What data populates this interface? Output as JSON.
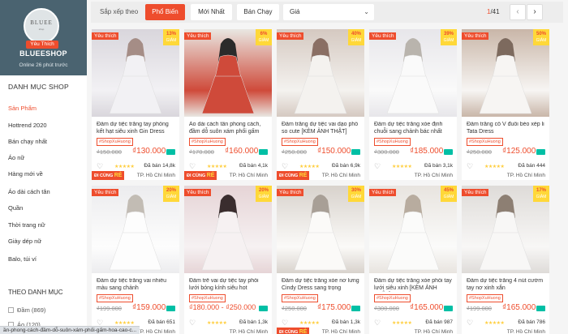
{
  "shop": {
    "logo_text": "BLUEE",
    "logo_sub": "shop",
    "favorite_badge": "Yêu Thích",
    "name": "BLUEESHOP",
    "online": "Online 26 phút trước"
  },
  "sidebar": {
    "category_title": "DANH MỤC SHOP",
    "categories": [
      {
        "label": "Sản Phẩm",
        "active": true
      },
      {
        "label": "Hottrend 2020"
      },
      {
        "label": "Bán chạy nhất"
      },
      {
        "label": "Áo nữ"
      },
      {
        "label": "Hàng mới về"
      },
      {
        "label": "Áo dài cách tân"
      },
      {
        "label": "Quần"
      },
      {
        "label": "Thời trang nữ"
      },
      {
        "label": "Giày dép nữ"
      },
      {
        "label": "Balo, túi ví"
      }
    ],
    "filter_title": "THEO DANH MỤC",
    "filters": [
      {
        "label": "Đầm (869)"
      },
      {
        "label": "Áo (120)"
      }
    ]
  },
  "sortbar": {
    "label": "Sắp xếp theo",
    "options": [
      {
        "label": "Phổ Biến",
        "active": true
      },
      {
        "label": "Mới Nhất"
      },
      {
        "label": "Bán Chạy"
      }
    ],
    "price_label": "Giá",
    "page_current": "1",
    "page_total": "/41",
    "prev_icon": "‹",
    "next_icon": "›"
  },
  "colors": {
    "accent": "#ee4d2d",
    "badge_yellow": "#ffd839",
    "shop_banner": "#4a6370"
  },
  "products": [
    {
      "fav": "Yêu thích",
      "discount": "13%",
      "discount_label": "GIẢM",
      "re": true,
      "name": "Đầm dự tiệc trắng tay phồng kết hạt siêu xinh Gin Dress",
      "tag": "#ShopXuHuong",
      "old_price": "₫150.000",
      "new_price": "₫130.000",
      "sold": "Đã bán 14,8k",
      "location": "TP. Hồ Chí Minh",
      "bg": [
        "#d9d6dc",
        "#f2f1f4",
        "#a58d86"
      ]
    },
    {
      "fav": "Yêu thích",
      "discount": "6%",
      "discount_label": "GIẢM",
      "re": true,
      "name": "Áo dài cách tân phong cách, đầm dỗ suôn xám phối gấm hoa",
      "tag": "#ShopXuHuong",
      "old_price": "₫170.000",
      "new_price": "₫160.000",
      "sold": "Đã bán 4,1k",
      "location": "TP. Hồ Chí Minh",
      "bg": [
        "#e9e7e2",
        "#cf4a3a",
        "#2b2b2b"
      ]
    },
    {
      "fav": "Yêu thích",
      "discount": "40%",
      "discount_label": "GIẢM",
      "re": true,
      "name": "Đầm trắng dự tiệc vai dạo phố so cute [KÈM ẢNH THẬT]",
      "tag": "#ShopXuHuong",
      "old_price": "₫250.000",
      "new_price": "₫150.000",
      "sold": "Đã bán 6,9k",
      "location": "TP. Hồ Chí Minh",
      "bg": [
        "#d5c9c1",
        "#f4f2ef",
        "#8a6f64"
      ]
    },
    {
      "fav": "Yêu thích",
      "discount": "39%",
      "discount_label": "GIẢM",
      "re": false,
      "name": "Đầm dự tiệc trắng xòe định chuỗi sang chảnh bác nhất",
      "tag": "#ShopXuHuong",
      "old_price": "₫300.000",
      "new_price": "₫185.000",
      "sold": "Đã bán 3,1k",
      "location": "TP. Hồ Chí Minh",
      "bg": [
        "#e7e6ea",
        "#fafafa",
        "#b9b4ad"
      ]
    },
    {
      "fav": "Yêu thích",
      "discount": "50%",
      "discount_label": "GIẢM",
      "re": false,
      "name": "Đầm trắng cổ V đuôi bèo xếp li Tata Dress",
      "tag": "#ShopXuHuong",
      "old_price": "₫250.000",
      "new_price": "₫125.000",
      "sold": "Đã bán 444",
      "location": "TP. Hồ Chí Minh",
      "bg": [
        "#c9b6a8",
        "#f7f5f3",
        "#7d6a5e"
      ]
    },
    {
      "fav": "Yêu thích",
      "discount": "20%",
      "discount_label": "GIẢM",
      "re": false,
      "name": "Đầm dự tiệc trắng vai nhiều màu sang chảnh",
      "tag": "#ShopXuHuong",
      "old_price": "₫199.000",
      "new_price": "₫159.000",
      "sold": "Đã bán 651",
      "location": "TP. Hồ Chí Minh",
      "bg": [
        "#ececee",
        "#fdfdfd",
        "#c2bcb4"
      ]
    },
    {
      "fav": "Yêu thích",
      "discount": "20%",
      "discount_label": "GIẢM",
      "re": false,
      "name": "Đầm trễ vai dự tiệc tay phối lưới bóng kính siêu hot",
      "tag": "#ShopXuHuong",
      "old_price": "",
      "new_price": "₫180.000 - ₫250.000",
      "sold": "Đã bán 1,3k",
      "location": "TP. Hồ Chí Minh",
      "bg": [
        "#e6d4d6",
        "#f6f1f2",
        "#3a2d2e"
      ]
    },
    {
      "fav": "Yêu thích",
      "discount": "30%",
      "discount_label": "GIẢM",
      "re": true,
      "name": "Đầm dự tiệc trắng xòe nơ lưng Cindy Dress sang trọng",
      "tag": "#ShopXuHuong",
      "old_price": "₫250.000",
      "new_price": "₫175.000",
      "sold": "Đã bán 1,3k",
      "location": "TP. Hồ Chí Minh",
      "bg": [
        "#d8d2cc",
        "#fbfaf8",
        "#a89f96"
      ]
    },
    {
      "fav": "Yêu thích",
      "discount": "45%",
      "discount_label": "GIẢM",
      "re": false,
      "name": "Đầm dự tiệc trắng xòe phối tay lưới siêu xinh [KÈM ẢNH THẬT]",
      "tag": "#ShopXuHuong",
      "old_price": "₫300.000",
      "new_price": "₫165.000",
      "sold": "Đã bán 987",
      "location": "TP. Hồ Chí Minh",
      "bg": [
        "#e8e4df",
        "#fbfbfa",
        "#b8ac9f"
      ]
    },
    {
      "fav": "Yêu thích",
      "discount": "17%",
      "discount_label": "GIẢM",
      "re": false,
      "name": "Đầm dự tiệc trắng 4 nút cườm tay nơ xinh xắn",
      "tag": "#ShopXuHuong",
      "old_price": "₫199.000",
      "new_price": "₫165.000",
      "sold": "Đã bán 786",
      "location": "TP. Hồ Chí Minh",
      "bg": [
        "#dedbd8",
        "#f8f7f6",
        "#8d7f73"
      ]
    }
  ],
  "status_url": "ần-phong-cách-đầm-dỗ-suôn-xám-phối-gấm-hoa-cao-c..."
}
